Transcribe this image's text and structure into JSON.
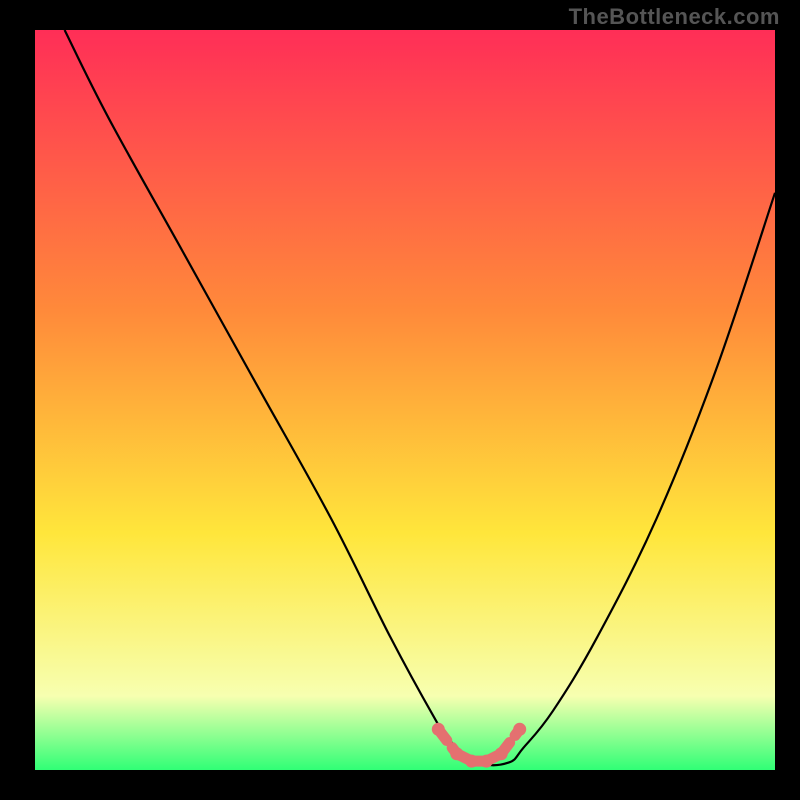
{
  "watermark": "TheBottleneck.com",
  "colors": {
    "frame": "#000000",
    "curve": "#000000",
    "marker": "#e47070",
    "gradient_top": "#ff2e57",
    "gradient_mid1": "#ff8a3a",
    "gradient_mid2": "#ffe63b",
    "gradient_mid3": "#f7ffb0",
    "gradient_bottom": "#30ff76"
  },
  "chart_data": {
    "type": "line",
    "title": "",
    "xlabel": "",
    "ylabel": "",
    "xlim": [
      0,
      100
    ],
    "ylim": [
      0,
      100
    ],
    "series": [
      {
        "name": "bottleneck-curve",
        "x": [
          4,
          10,
          20,
          30,
          40,
          48,
          54,
          56,
          60,
          64,
          66,
          70,
          76,
          84,
          92,
          100
        ],
        "y": [
          100,
          88,
          70,
          52,
          34,
          18,
          7,
          4,
          1,
          1,
          3,
          8,
          18,
          34,
          54,
          78
        ]
      }
    ],
    "markers": {
      "name": "highlight-points",
      "x": [
        54.5,
        57,
        59,
        61,
        63,
        65.5
      ],
      "y": [
        5.5,
        2.2,
        1.2,
        1.2,
        2.2,
        5.5
      ]
    },
    "gradient_stops": [
      {
        "offset": 0,
        "color": "#ff2e57"
      },
      {
        "offset": 38,
        "color": "#ff8a3a"
      },
      {
        "offset": 68,
        "color": "#ffe63b"
      },
      {
        "offset": 90,
        "color": "#f7ffb0"
      },
      {
        "offset": 100,
        "color": "#30ff76"
      }
    ]
  }
}
